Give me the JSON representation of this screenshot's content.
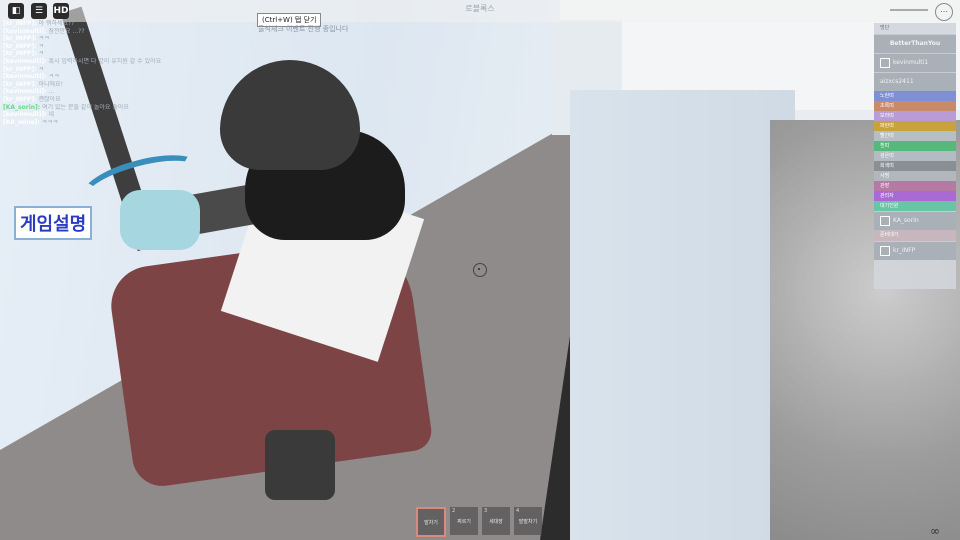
{
  "window": {
    "title": "로블록스"
  },
  "topbar": {
    "roblox_icon": "roblox-logo-icon",
    "chat_icon": "chat-icon",
    "hd_label": "HD",
    "tooltip": "(Ctrl+W) 탭 닫기",
    "notice": "출석체크 이벤트 진행 중입니다",
    "menu_icon": "more-options-icon"
  },
  "chat": [
    {
      "name": "[kr_INFP]:",
      "name_color": "#ffffff",
      "msg": "아 뭐하세요??"
    },
    {
      "name": "[kevinmulti]:",
      "name_color": "#ffffff",
      "msg": "잠깐만요 ...??"
    },
    {
      "name": "[kr_INFP]:",
      "name_color": "#ffffff",
      "msg": "ㅋㅋ"
    },
    {
      "name": "[kr_INFP]:",
      "name_color": "#ffffff",
      "msg": "ㅋ"
    },
    {
      "name": "[kr_INFP]:",
      "name_color": "#ffffff",
      "msg": "ㅋ"
    },
    {
      "name": "[kevinmulti]:",
      "name_color": "#ffffff",
      "msg": "혹시 입력하시면 다 같이 유치원 갈 수 있어요"
    },
    {
      "name": "[kr_INFP]:",
      "name_color": "#ffffff",
      "msg": "ㅋ"
    },
    {
      "name": "[kevinmulti]:",
      "name_color": "#ffffff",
      "msg": "ㅋㅋ"
    },
    {
      "name": "[kr_INFP]:",
      "name_color": "#ffffff",
      "msg": "아니에요!"
    },
    {
      "name": "[kevinmulti]:",
      "name_color": "#ffffff",
      "msg": "..."
    },
    {
      "name": "[kr_INFP]:",
      "name_color": "#ffffff",
      "msg": "괜찮아요"
    },
    {
      "name": "[KA_sorin]:",
      "name_color": "#67d98a",
      "msg": "여기 있는 분들 같이 놀아요 좋아요"
    },
    {
      "name": "[kevinmulti]:",
      "name_color": "#ffffff",
      "msg": "네"
    },
    {
      "name": "[KR_mine]:",
      "name_color": "#ffffff",
      "msg": "ㅋㅋㅋ"
    }
  ],
  "sign": {
    "text": "게임설명"
  },
  "playerlist": {
    "header": "명단",
    "me": "BetterThanYou",
    "players_top": [
      "kevinmulti1",
      "aizxcs2411"
    ],
    "teams": [
      {
        "label": "노란띠",
        "color": "#7f8fd6"
      },
      {
        "label": "초록띠",
        "color": "#c98a6a"
      },
      {
        "label": "보라띠",
        "color": "#b99bd6"
      },
      {
        "label": "파란띠",
        "color": "#c8a23a"
      },
      {
        "label": "빨간띠",
        "color": "#b8bec5"
      },
      {
        "label": "흰띠",
        "color": "#56b97a"
      },
      {
        "label": "검은띠",
        "color": "#b5bbc2"
      },
      {
        "label": "회색띠",
        "color": "#8a8f94"
      },
      {
        "label": "사범",
        "color": "#b2b7bd"
      },
      {
        "label": "관장",
        "color": "#b47aa4"
      },
      {
        "label": "관리자",
        "color": "#a96ad3"
      },
      {
        "label": "대기인원",
        "color": "#6ac4a6"
      }
    ],
    "player_mid": "KA_sorin",
    "team_bottom": "준비대기",
    "team_bottom_color": "#c8b6be",
    "player_bottom": "kr_INFP"
  },
  "hotbar": [
    {
      "num": "",
      "label": "발차기"
    },
    {
      "num": "2",
      "label": "찌르기"
    },
    {
      "num": "3",
      "label": "세대장"
    },
    {
      "num": "4",
      "label": "발발차기"
    }
  ],
  "bottom_right_icon": "vr-glasses-icon",
  "bottom_right_glyph": "∞"
}
